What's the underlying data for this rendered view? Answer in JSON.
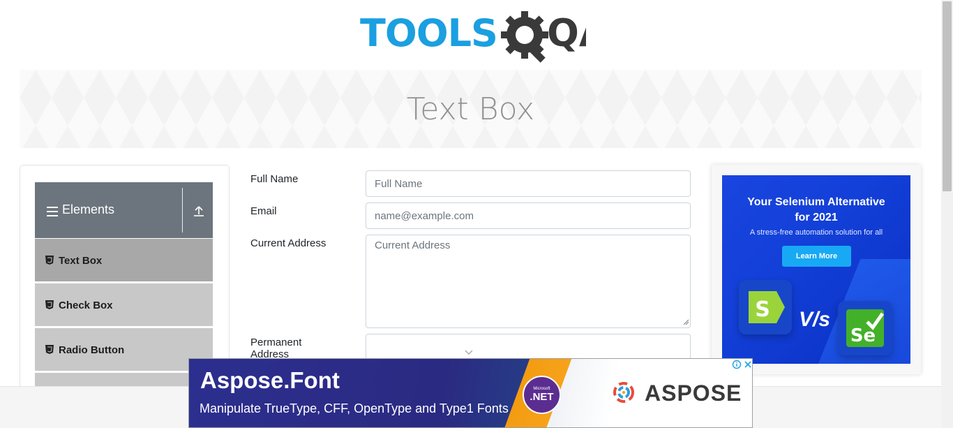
{
  "header": {
    "logo_text_left": "TOOLS",
    "logo_text_right": "QA"
  },
  "banner": {
    "title": "Text Box"
  },
  "sidebar": {
    "group_title": "Elements",
    "items": [
      {
        "label": "Text Box"
      },
      {
        "label": "Check Box"
      },
      {
        "label": "Radio Button"
      }
    ]
  },
  "form": {
    "full_name": {
      "label": "Full Name",
      "placeholder": "Full Name"
    },
    "email": {
      "label": "Email",
      "placeholder": "name@example.com"
    },
    "current_address": {
      "label": "Current Address",
      "placeholder": "Current Address"
    },
    "permanent_address": {
      "label_line1": "Permanent",
      "label_line2": "Address"
    }
  },
  "ad_right": {
    "title_line1": "Your Selenium Alternative",
    "title_line2": "for 2021",
    "subtitle": "A stress-free automation solution for all",
    "button": "Learn More",
    "vs": "V/s",
    "colors": {
      "background": "#1a45e0",
      "button": "#18a9f5"
    }
  },
  "ad_bottom": {
    "title": "Aspose.Font",
    "subtitle": "Manipulate TrueType, CFF, OpenType and Type1 Fonts",
    "badge_small": "Microsoft",
    "badge_main": ".NET",
    "brand": "ASPOSE"
  },
  "colors": {
    "logo_blue": "#1b9fe0",
    "logo_dark": "#3a3a3a",
    "sidebar_header": "#6c757d"
  }
}
